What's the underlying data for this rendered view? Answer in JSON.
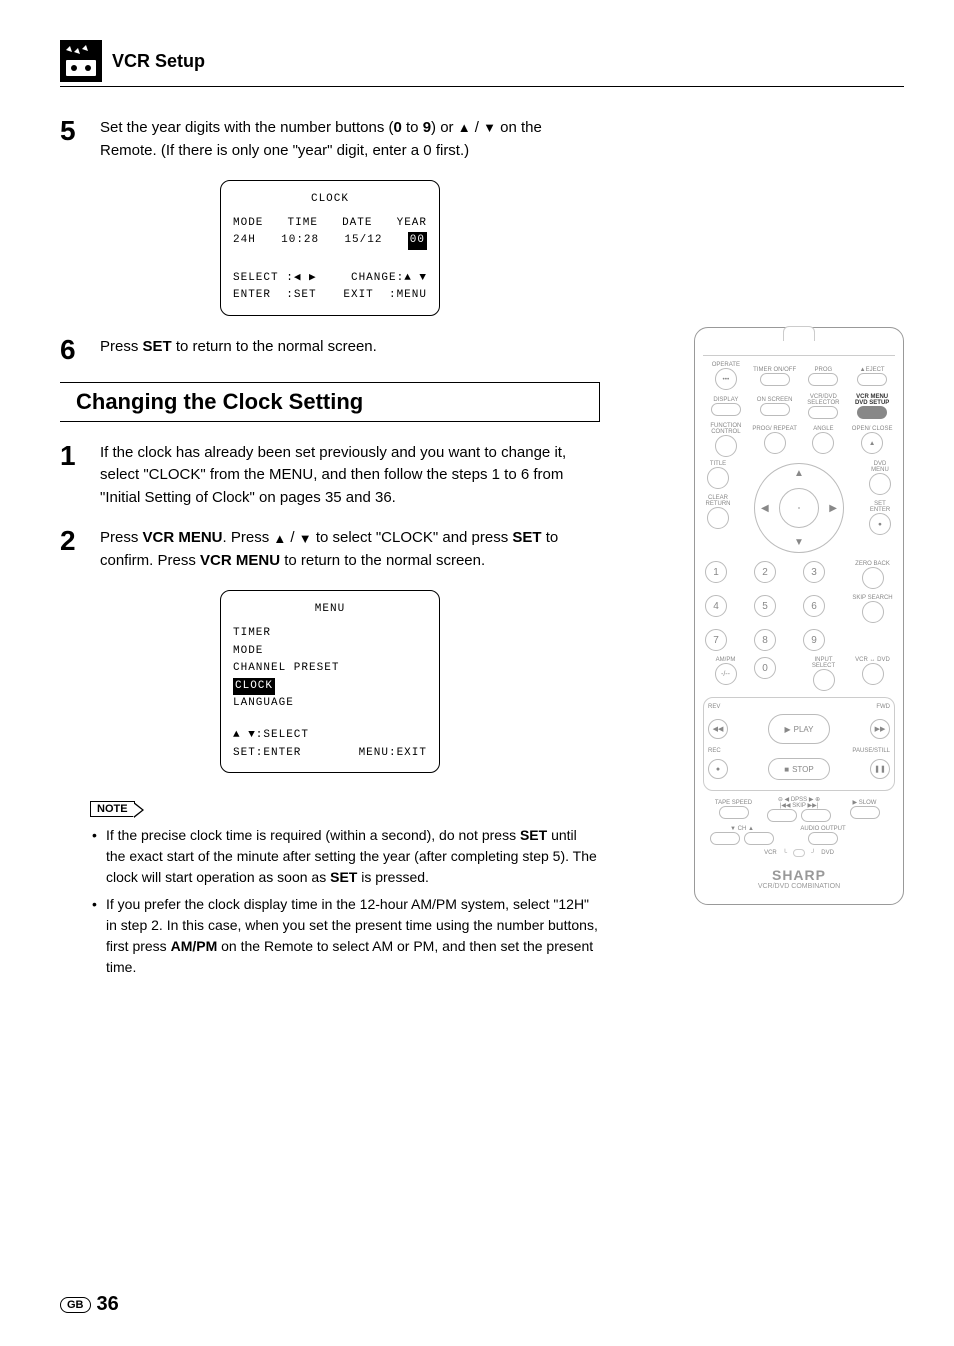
{
  "header": {
    "title": "VCR Setup"
  },
  "step5": {
    "num": "5",
    "pre": "Set the year digits with the number buttons (",
    "range": "0",
    "to": " to ",
    "range2": "9",
    "post1": ") or ",
    "post2": " / ",
    "post3": " on the Remote. (If there is only one \"year\" digit, enter a 0 first.)"
  },
  "clock_osd": {
    "title": "CLOCK",
    "h1": "MODE",
    "h2": "TIME",
    "h3": "DATE",
    "h4": "YEAR",
    "v1": "24H",
    "v2": "10:28",
    "v3": "15/12",
    "v4": "00",
    "f1a": "SELECT",
    "f1b": ":◀ ▶",
    "f2a": "CHANGE:",
    "f2b": "▲ ▼",
    "f3a": "ENTER",
    "f3b": ":SET",
    "f4a": "EXIT",
    "f4b": ":MENU"
  },
  "step6": {
    "num": "6",
    "pre": "Press ",
    "b1": "SET",
    "post": " to return to the normal screen."
  },
  "section_heading": "Changing the Clock Setting",
  "csStep1": {
    "num": "1",
    "text": "If the clock has already been set previously and you want to change it, select \"CLOCK\" from the MENU, and then follow the steps 1 to 6 from \"Initial Setting of Clock\" on pages 35 and 36."
  },
  "csStep2": {
    "num": "2",
    "pre": "Press ",
    "b1": "VCR MENU",
    "mid1": ". Press ",
    "mid2": " / ",
    "mid3": " to select \"CLOCK\" and press ",
    "b2": "SET",
    "mid4": " to confirm. Press ",
    "b3": "VCR MENU",
    "post": " to return to the normal screen."
  },
  "menu_osd": {
    "title": "MENU",
    "items": [
      "TIMER",
      "MODE",
      "CHANNEL PRESET",
      "CLOCK",
      "LANGUAGE"
    ],
    "selected": "CLOCK",
    "f1": "▲ ▼:SELECT",
    "f2a": "SET:ENTER",
    "f2b": "MENU:EXIT"
  },
  "note_label": "NOTE",
  "notes": [
    {
      "pre": "If the precise clock time is required (within a second), do not press ",
      "b1": "SET",
      "mid": " until the exact start of the minute after setting the year (after completing step 5). The clock will start operation as soon as ",
      "b2": "SET",
      "post": " is pressed."
    },
    {
      "pre": "If you prefer the clock display time in the 12-hour AM/PM system, select \"12H\" in step 2. In this case, when you set the present time using the number buttons, first press ",
      "b1": "AM/PM",
      "post": " on the Remote to select AM or PM, and then set the present time."
    }
  ],
  "remote": {
    "row1": [
      "OPERATE",
      "TIMER ON/OFF",
      "PROG",
      "▲EJECT"
    ],
    "row2": [
      "DISPLAY",
      "ON SCREEN",
      "VCR/DVD SELECTOR",
      "VCR MENU DVD SETUP"
    ],
    "row3": [
      "FUNCTION CONTROL",
      "PROG/ REPEAT",
      "ANGLE",
      "OPEN/ CLOSE"
    ],
    "title_lbl": "TITLE",
    "dvdmenu_lbl": "DVD MENU",
    "clear_lbl": "CLEAR RETURN",
    "set_lbl": "SET ENTER",
    "zero_lbl": "ZERO BACK",
    "skip_lbl": "SKIP SEARCH",
    "ampm_lbl": "AM/PM",
    "input_lbl": "INPUT SELECT",
    "vcrdvd_lbl": "VCR ↔ DVD",
    "rev": "REV",
    "fwd": "FWD",
    "play": "PLAY",
    "rec": "REC",
    "stop": "STOP",
    "pause": "PAUSE/STILL",
    "tape_lbl": "TAPE SPEED",
    "dpss_lbl": "DPSS",
    "skip2_lbl": "SKIP",
    "slow_lbl": "SLOW",
    "ch_lbl": "CH",
    "audio_lbl": "AUDIO OUTPUT",
    "vcr_led": "VCR",
    "dvd_led": "DVD",
    "brand": "SHARP",
    "brand_sub": "VCR/DVD COMBINATION",
    "nums": [
      "1",
      "2",
      "3",
      "4",
      "5",
      "6",
      "7",
      "8",
      "9",
      "-/--",
      "0"
    ]
  },
  "footer": {
    "gb": "GB",
    "page": "36"
  }
}
